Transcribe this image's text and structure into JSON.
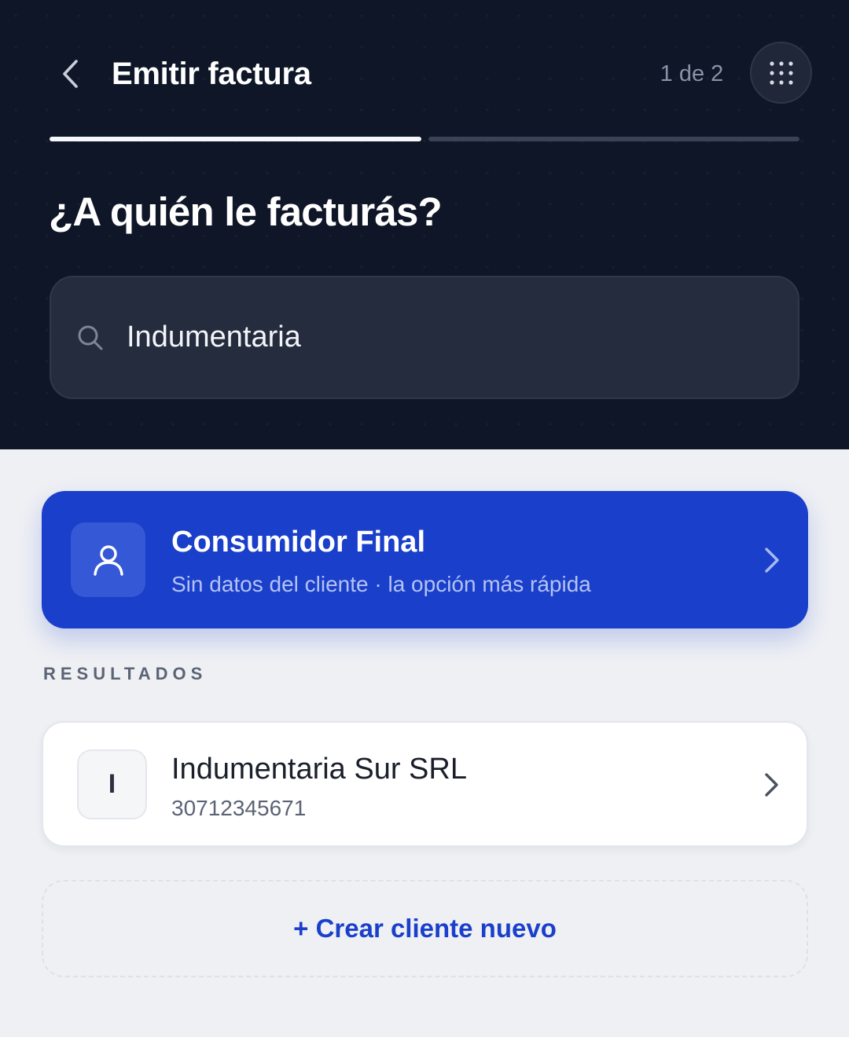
{
  "header": {
    "title": "Emitir factura",
    "step": "1 de 2",
    "progress": {
      "current_step": 1,
      "total_steps": 2
    },
    "question": "¿A quién le facturás?"
  },
  "search": {
    "value": "Indumentaria",
    "icon": "search-icon"
  },
  "consumidor_final": {
    "title": "Consumidor Final",
    "subtitle": "Sin datos del cliente · la opción más rápida",
    "icon": "user-icon"
  },
  "results": {
    "label": "RESULTADOS",
    "items": [
      {
        "initial": "I",
        "name": "Indumentaria Sur SRL",
        "id": "30712345671"
      }
    ]
  },
  "create_label": "+ Crear cliente nuevo",
  "colors": {
    "header_bg": "#0e1627",
    "accent": "#1a3fca",
    "page_bg": "#eef0f4"
  }
}
